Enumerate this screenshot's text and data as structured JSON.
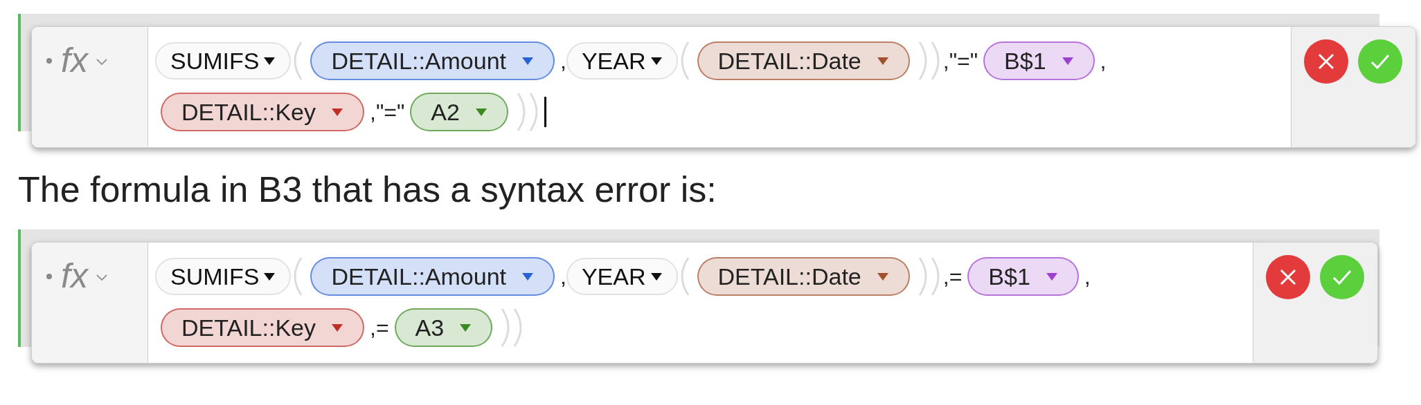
{
  "sections": [
    {
      "kind": "editor",
      "label": "fx",
      "caret": true,
      "lines": [
        [
          {
            "kind": "function",
            "text": "SUMIFS"
          },
          {
            "kind": "open"
          },
          {
            "kind": "ref",
            "text": "DETAIL::Amount",
            "color": "#2a62d6"
          },
          {
            "kind": "text",
            "text": ","
          },
          {
            "kind": "function",
            "text": "YEAR"
          },
          {
            "kind": "open"
          },
          {
            "kind": "ref",
            "text": "DETAIL::Date",
            "color": "#a0522d"
          },
          {
            "kind": "close"
          },
          {
            "kind": "text",
            "text": ",\"=\""
          },
          {
            "kind": "ref",
            "text": "B$1",
            "color": "#9b40d0"
          },
          {
            "kind": "text",
            "text": ","
          }
        ],
        [
          {
            "kind": "ref",
            "text": "DETAIL::Key",
            "color": "#c0302a"
          },
          {
            "kind": "text",
            "text": ",\"=\""
          },
          {
            "kind": "ref",
            "text": "A2",
            "color": "#3a8a20"
          },
          {
            "kind": "close"
          }
        ]
      ]
    },
    {
      "kind": "paragraph",
      "text": "The formula in B3 that has a syntax error is:"
    },
    {
      "kind": "editor",
      "label": "fx",
      "caret": false,
      "lines": [
        [
          {
            "kind": "function",
            "text": "SUMIFS"
          },
          {
            "kind": "open"
          },
          {
            "kind": "ref",
            "text": "DETAIL::Amount",
            "color": "#2a62d6"
          },
          {
            "kind": "text",
            "text": ","
          },
          {
            "kind": "function",
            "text": "YEAR"
          },
          {
            "kind": "open"
          },
          {
            "kind": "ref",
            "text": "DETAIL::Date",
            "color": "#a0522d"
          },
          {
            "kind": "close"
          },
          {
            "kind": "text",
            "text": ",="
          },
          {
            "kind": "ref",
            "text": "B$1",
            "color": "#9b40d0"
          },
          {
            "kind": "text",
            "text": ","
          }
        ],
        [
          {
            "kind": "ref",
            "text": "DETAIL::Key",
            "color": "#c0302a"
          },
          {
            "kind": "text",
            "text": ",="
          },
          {
            "kind": "ref",
            "text": "A3",
            "color": "#3a8a20"
          },
          {
            "kind": "close"
          }
        ]
      ]
    }
  ]
}
